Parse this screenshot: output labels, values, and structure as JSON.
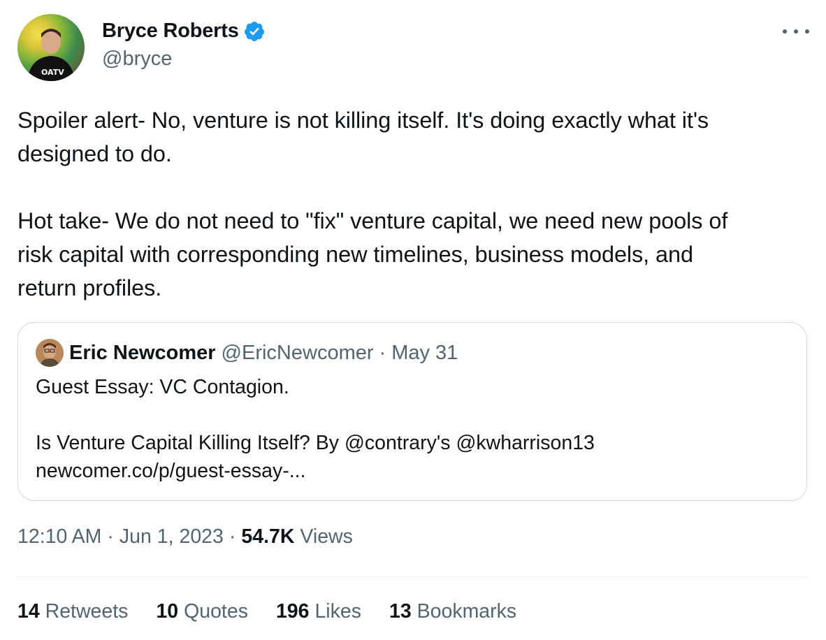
{
  "author": {
    "name": "Bryce Roberts",
    "handle": "@bryce",
    "verified": true,
    "avatar_shirt_text": "OATV"
  },
  "tweet": {
    "text": "Spoiler alert- No, venture is not killing itself. It's doing exactly what it's\ndesigned to do.\n\nHot take- We do not need to \"fix\" venture capital, we need new pools of\nrisk capital with corresponding new timelines, business models, and\nreturn profiles."
  },
  "quoted": {
    "name": "Eric Newcomer",
    "handle": "@EricNewcomer",
    "separator": "·",
    "date": "May 31",
    "text": "Guest Essay: VC Contagion.\n\nIs Venture Capital Killing Itself? By @contrary's @kwharrison13\nnewcomer.co/p/guest-essay-..."
  },
  "meta": {
    "time": "12:10 AM",
    "sep1": "·",
    "date": "Jun 1, 2023",
    "sep2": "·",
    "views_count": "54.7K",
    "views_label": "Views"
  },
  "stats": [
    {
      "count": "14",
      "label": "Retweets"
    },
    {
      "count": "10",
      "label": "Quotes"
    },
    {
      "count": "196",
      "label": "Likes"
    },
    {
      "count": "13",
      "label": "Bookmarks"
    }
  ],
  "colors": {
    "verified": "#1d9bf0",
    "secondary_text": "#536471",
    "border": "#cfd9de"
  }
}
